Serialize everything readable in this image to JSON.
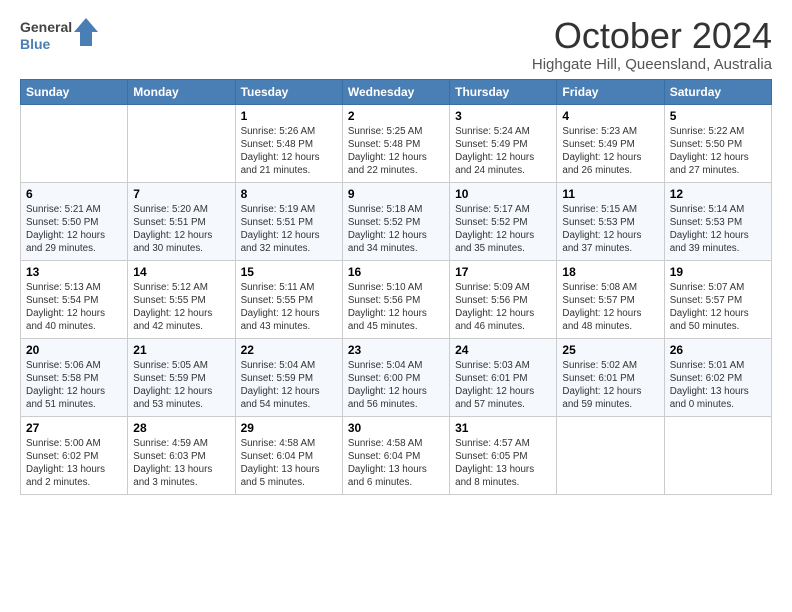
{
  "header": {
    "logo_line1": "General",
    "logo_line2": "Blue",
    "month": "October 2024",
    "location": "Highgate Hill, Queensland, Australia"
  },
  "days_of_week": [
    "Sunday",
    "Monday",
    "Tuesday",
    "Wednesday",
    "Thursday",
    "Friday",
    "Saturday"
  ],
  "weeks": [
    [
      {
        "day": "",
        "info": ""
      },
      {
        "day": "",
        "info": ""
      },
      {
        "day": "1",
        "info": "Sunrise: 5:26 AM\nSunset: 5:48 PM\nDaylight: 12 hours\nand 21 minutes."
      },
      {
        "day": "2",
        "info": "Sunrise: 5:25 AM\nSunset: 5:48 PM\nDaylight: 12 hours\nand 22 minutes."
      },
      {
        "day": "3",
        "info": "Sunrise: 5:24 AM\nSunset: 5:49 PM\nDaylight: 12 hours\nand 24 minutes."
      },
      {
        "day": "4",
        "info": "Sunrise: 5:23 AM\nSunset: 5:49 PM\nDaylight: 12 hours\nand 26 minutes."
      },
      {
        "day": "5",
        "info": "Sunrise: 5:22 AM\nSunset: 5:50 PM\nDaylight: 12 hours\nand 27 minutes."
      }
    ],
    [
      {
        "day": "6",
        "info": "Sunrise: 5:21 AM\nSunset: 5:50 PM\nDaylight: 12 hours\nand 29 minutes."
      },
      {
        "day": "7",
        "info": "Sunrise: 5:20 AM\nSunset: 5:51 PM\nDaylight: 12 hours\nand 30 minutes."
      },
      {
        "day": "8",
        "info": "Sunrise: 5:19 AM\nSunset: 5:51 PM\nDaylight: 12 hours\nand 32 minutes."
      },
      {
        "day": "9",
        "info": "Sunrise: 5:18 AM\nSunset: 5:52 PM\nDaylight: 12 hours\nand 34 minutes."
      },
      {
        "day": "10",
        "info": "Sunrise: 5:17 AM\nSunset: 5:52 PM\nDaylight: 12 hours\nand 35 minutes."
      },
      {
        "day": "11",
        "info": "Sunrise: 5:15 AM\nSunset: 5:53 PM\nDaylight: 12 hours\nand 37 minutes."
      },
      {
        "day": "12",
        "info": "Sunrise: 5:14 AM\nSunset: 5:53 PM\nDaylight: 12 hours\nand 39 minutes."
      }
    ],
    [
      {
        "day": "13",
        "info": "Sunrise: 5:13 AM\nSunset: 5:54 PM\nDaylight: 12 hours\nand 40 minutes."
      },
      {
        "day": "14",
        "info": "Sunrise: 5:12 AM\nSunset: 5:55 PM\nDaylight: 12 hours\nand 42 minutes."
      },
      {
        "day": "15",
        "info": "Sunrise: 5:11 AM\nSunset: 5:55 PM\nDaylight: 12 hours\nand 43 minutes."
      },
      {
        "day": "16",
        "info": "Sunrise: 5:10 AM\nSunset: 5:56 PM\nDaylight: 12 hours\nand 45 minutes."
      },
      {
        "day": "17",
        "info": "Sunrise: 5:09 AM\nSunset: 5:56 PM\nDaylight: 12 hours\nand 46 minutes."
      },
      {
        "day": "18",
        "info": "Sunrise: 5:08 AM\nSunset: 5:57 PM\nDaylight: 12 hours\nand 48 minutes."
      },
      {
        "day": "19",
        "info": "Sunrise: 5:07 AM\nSunset: 5:57 PM\nDaylight: 12 hours\nand 50 minutes."
      }
    ],
    [
      {
        "day": "20",
        "info": "Sunrise: 5:06 AM\nSunset: 5:58 PM\nDaylight: 12 hours\nand 51 minutes."
      },
      {
        "day": "21",
        "info": "Sunrise: 5:05 AM\nSunset: 5:59 PM\nDaylight: 12 hours\nand 53 minutes."
      },
      {
        "day": "22",
        "info": "Sunrise: 5:04 AM\nSunset: 5:59 PM\nDaylight: 12 hours\nand 54 minutes."
      },
      {
        "day": "23",
        "info": "Sunrise: 5:04 AM\nSunset: 6:00 PM\nDaylight: 12 hours\nand 56 minutes."
      },
      {
        "day": "24",
        "info": "Sunrise: 5:03 AM\nSunset: 6:01 PM\nDaylight: 12 hours\nand 57 minutes."
      },
      {
        "day": "25",
        "info": "Sunrise: 5:02 AM\nSunset: 6:01 PM\nDaylight: 12 hours\nand 59 minutes."
      },
      {
        "day": "26",
        "info": "Sunrise: 5:01 AM\nSunset: 6:02 PM\nDaylight: 13 hours\nand 0 minutes."
      }
    ],
    [
      {
        "day": "27",
        "info": "Sunrise: 5:00 AM\nSunset: 6:02 PM\nDaylight: 13 hours\nand 2 minutes."
      },
      {
        "day": "28",
        "info": "Sunrise: 4:59 AM\nSunset: 6:03 PM\nDaylight: 13 hours\nand 3 minutes."
      },
      {
        "day": "29",
        "info": "Sunrise: 4:58 AM\nSunset: 6:04 PM\nDaylight: 13 hours\nand 5 minutes."
      },
      {
        "day": "30",
        "info": "Sunrise: 4:58 AM\nSunset: 6:04 PM\nDaylight: 13 hours\nand 6 minutes."
      },
      {
        "day": "31",
        "info": "Sunrise: 4:57 AM\nSunset: 6:05 PM\nDaylight: 13 hours\nand 8 minutes."
      },
      {
        "day": "",
        "info": ""
      },
      {
        "day": "",
        "info": ""
      }
    ]
  ]
}
